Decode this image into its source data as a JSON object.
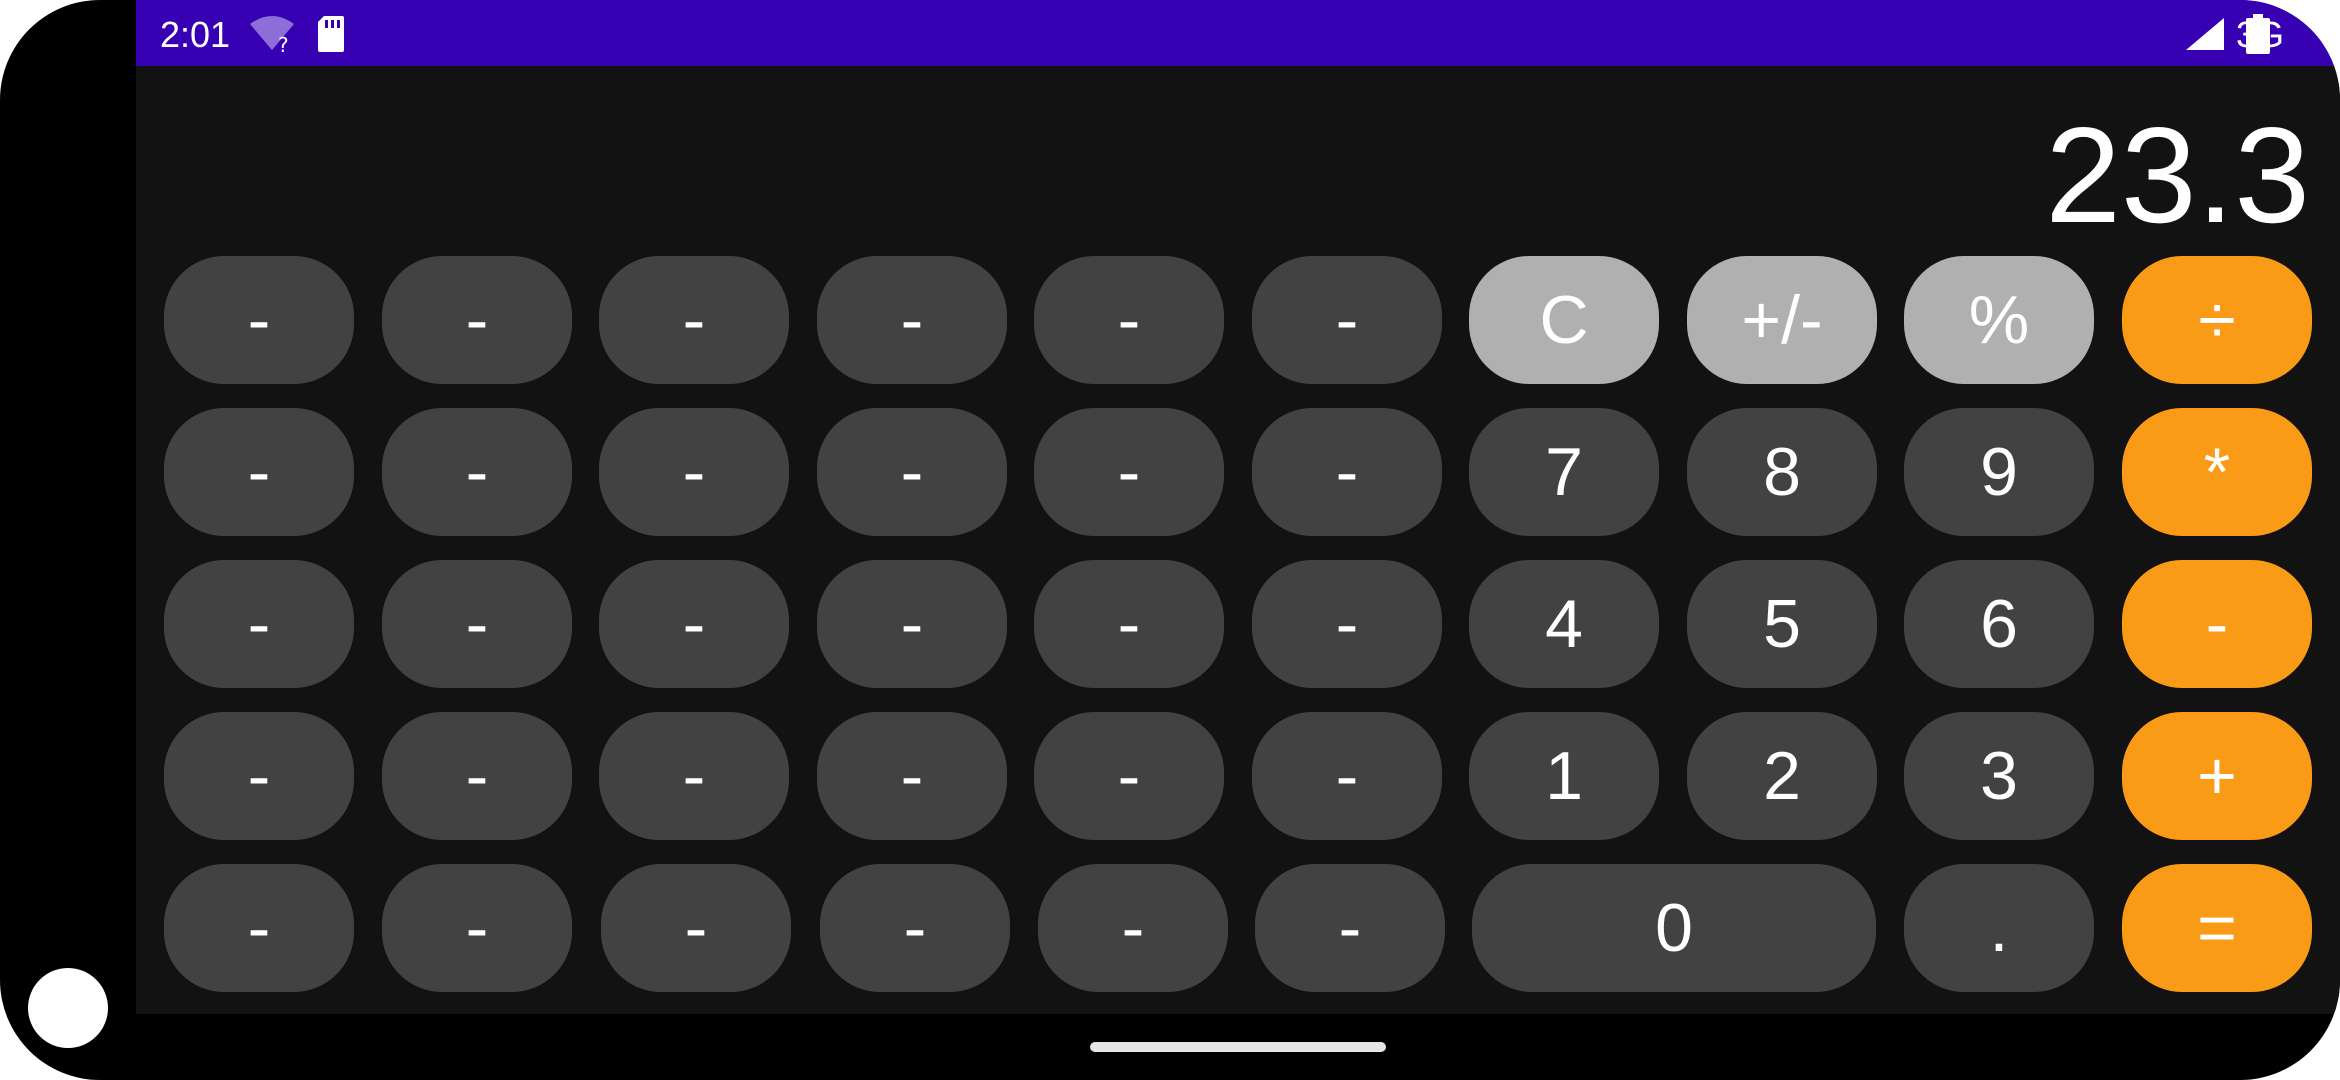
{
  "status_bar": {
    "time": "2:01",
    "network": "3G",
    "background_color": "#3700b3",
    "icons": [
      "wifi-unknown-icon",
      "sd-card-icon",
      "signal-icon",
      "battery-icon"
    ]
  },
  "calculator": {
    "display_value": "23.3",
    "keypad": {
      "rows": [
        [
          "-",
          "-",
          "-",
          "-",
          "-",
          "-",
          "C",
          "+/-",
          "%",
          "÷"
        ],
        [
          "-",
          "-",
          "-",
          "-",
          "-",
          "-",
          "7",
          "8",
          "9",
          "*"
        ],
        [
          "-",
          "-",
          "-",
          "-",
          "-",
          "-",
          "4",
          "5",
          "6",
          "-"
        ],
        [
          "-",
          "-",
          "-",
          "-",
          "-",
          "-",
          "1",
          "2",
          "3",
          "+"
        ],
        [
          "-",
          "-",
          "-",
          "-",
          "-",
          "-",
          "0",
          ".",
          "="
        ]
      ]
    },
    "colors": {
      "background": "#121212",
      "number_key": "#424242",
      "function_key": "#b0b0b0",
      "operator_key": "#f99b17"
    }
  }
}
